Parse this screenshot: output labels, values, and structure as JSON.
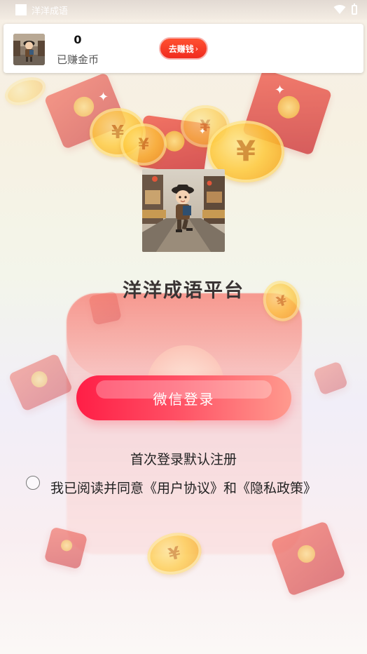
{
  "status_bar": {
    "title": "洋洋成语"
  },
  "earn_bar": {
    "amount": "0",
    "label": "已赚金币",
    "button": "去赚钱"
  },
  "main": {
    "platform_title": "洋洋成语平台",
    "wechat_login": "微信登录",
    "first_login_note": "首次登录默认注册",
    "agreement": "我已阅读并同意《用户协议》和《隐私政策》"
  },
  "colors": {
    "accent": "#ff2a4a",
    "earn_button": "#f53a24",
    "title_text": "#3a3434"
  }
}
